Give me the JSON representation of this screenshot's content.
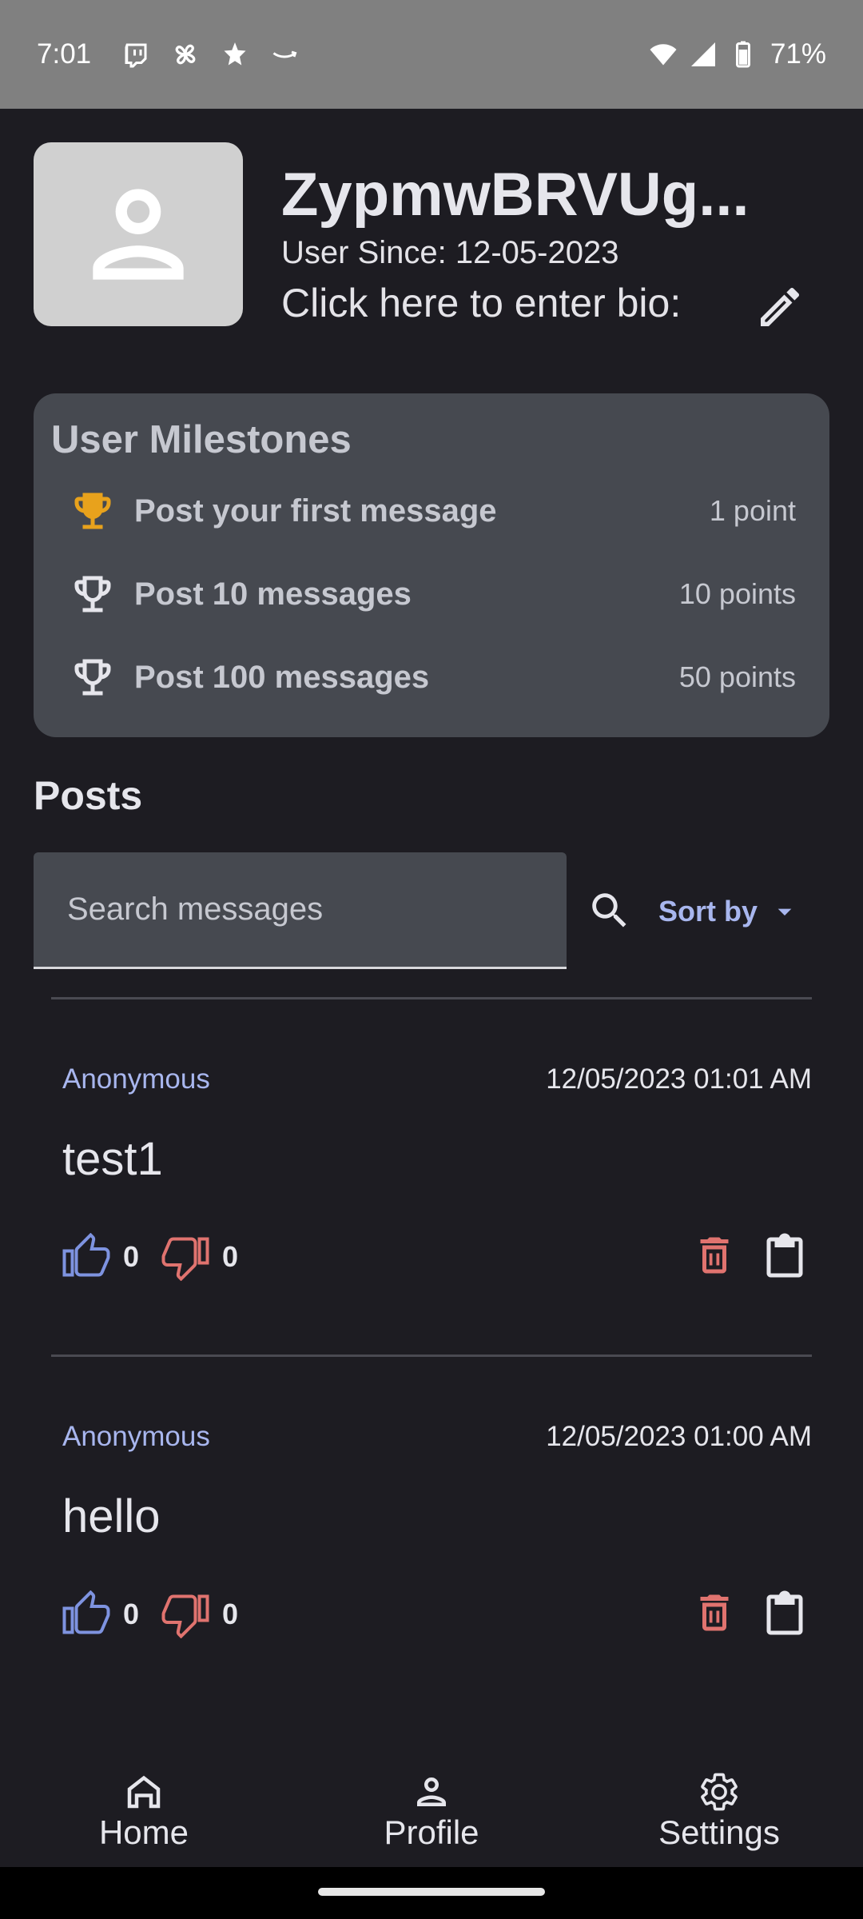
{
  "status_bar": {
    "time": "7:01",
    "battery": "71%",
    "notification_icons": [
      "twitch-icon",
      "pinwheel-icon",
      "puzzle-icon",
      "amazon-icon"
    ]
  },
  "profile": {
    "username": "ZypmwBRVUg...",
    "user_since": "User Since: 12-05-2023",
    "bio_placeholder": "Click here to enter bio:"
  },
  "milestones": {
    "title": "User Milestones",
    "items": [
      {
        "label": "Post your first message",
        "points": "1 point",
        "achieved": true
      },
      {
        "label": "Post 10 messages",
        "points": "10 points",
        "achieved": false
      },
      {
        "label": "Post 100 messages",
        "points": "50 points",
        "achieved": false
      }
    ]
  },
  "posts_section": {
    "title": "Posts",
    "search_placeholder": "Search messages",
    "sort_label": "Sort by"
  },
  "posts": [
    {
      "author": "Anonymous",
      "date": "12/05/2023 01:01 AM",
      "text": "test1",
      "likes": "0",
      "dislikes": "0"
    },
    {
      "author": "Anonymous",
      "date": "12/05/2023 01:00 AM",
      "text": "hello",
      "likes": "0",
      "dislikes": "0"
    }
  ],
  "bottom_nav": {
    "items": [
      {
        "label": "Home",
        "icon": "home-icon"
      },
      {
        "label": "Profile",
        "icon": "person-icon"
      },
      {
        "label": "Settings",
        "icon": "gear-icon"
      }
    ]
  },
  "colors": {
    "background": "#1d1c22",
    "card": "#464950",
    "accent": "#a8b6ee",
    "trophy_gold": "#e8a21c",
    "dislike_red": "#e0736f"
  }
}
